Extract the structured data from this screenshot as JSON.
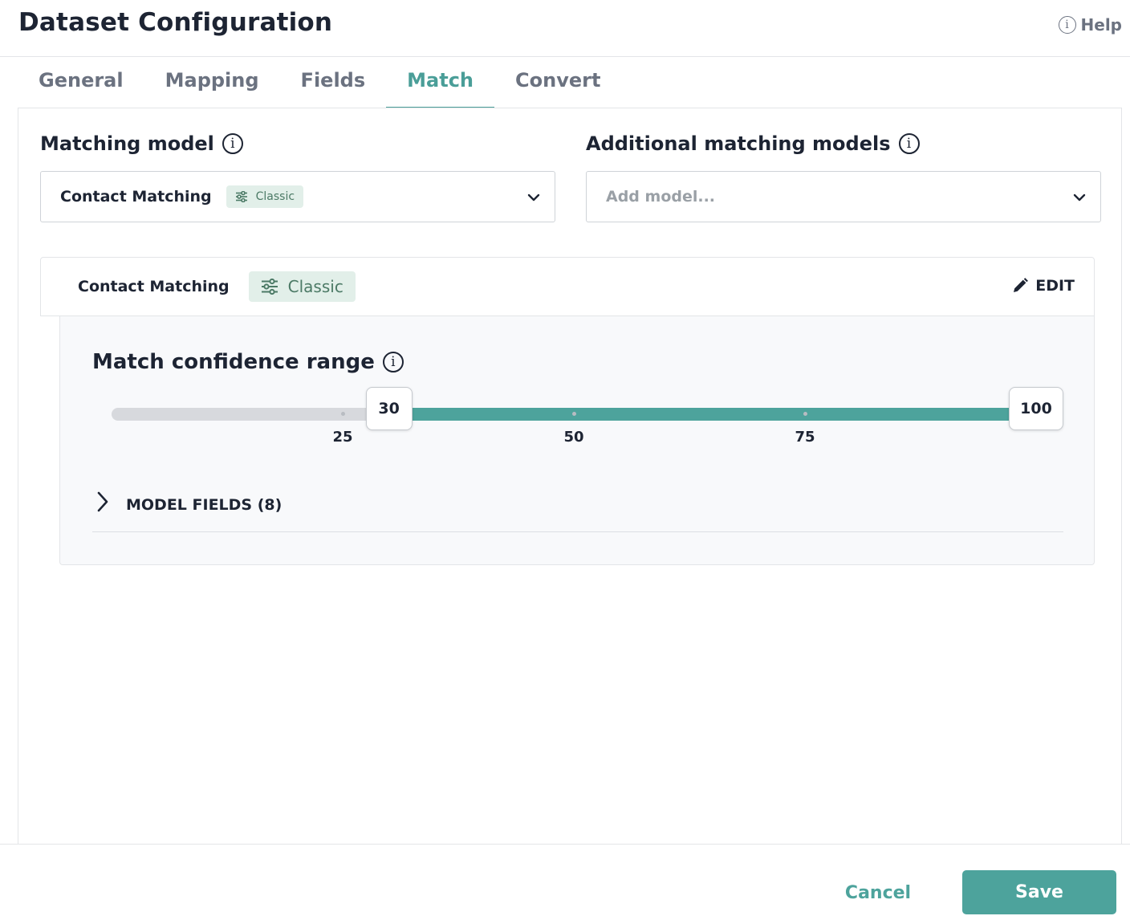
{
  "header": {
    "title": "Dataset Configuration",
    "help_label": "Help"
  },
  "tabs": [
    {
      "label": "General",
      "active": false
    },
    {
      "label": "Mapping",
      "active": false
    },
    {
      "label": "Fields",
      "active": false
    },
    {
      "label": "Match",
      "active": true
    },
    {
      "label": "Convert",
      "active": false
    }
  ],
  "matching_model": {
    "label": "Matching model",
    "selected": "Contact Matching",
    "badge": "Classic"
  },
  "additional_models": {
    "label": "Additional matching models",
    "placeholder": "Add model..."
  },
  "model_card": {
    "name": "Contact Matching",
    "badge": "Classic",
    "edit_label": "EDIT",
    "range_label": "Match confidence range",
    "range": {
      "min": 0,
      "max": 100,
      "low": 30,
      "high": 100,
      "marks": [
        25,
        50,
        75
      ]
    },
    "fields_toggle": "MODEL FIELDS (8)"
  },
  "footer": {
    "cancel_label": "Cancel",
    "save_label": "Save"
  },
  "colors": {
    "accent": "#4da39c",
    "badge_bg": "#e2efe9",
    "badge_text": "#4c7a66"
  }
}
